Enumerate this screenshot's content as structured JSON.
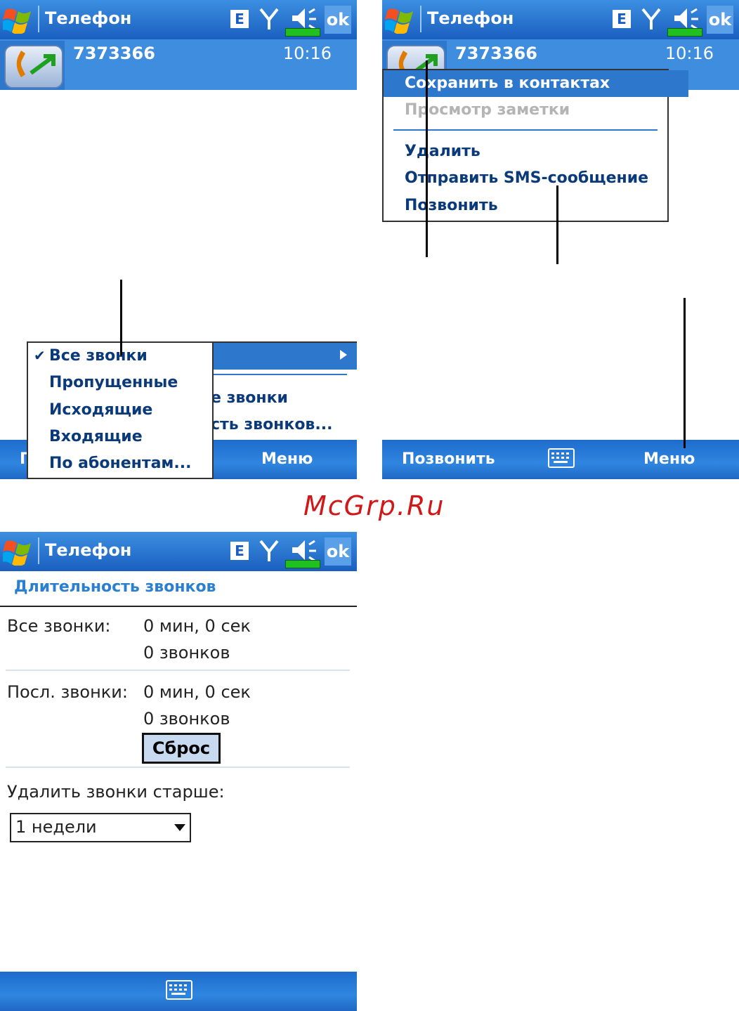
{
  "title_bar": {
    "title": "Телефон",
    "e_label": "E",
    "ok_label": "ok"
  },
  "call_info": {
    "number": "7373366",
    "time": "10:16"
  },
  "screen1": {
    "filter_menu": {
      "items": [
        {
          "label": "Все звонки",
          "checked": true
        },
        {
          "label": "Пропущенные",
          "checked": false
        },
        {
          "label": "Исходящие",
          "checked": false
        },
        {
          "label": "Входящие",
          "checked": false
        },
        {
          "label": "По абонентам...",
          "checked": false
        }
      ],
      "check_mark": "✔"
    },
    "main_menu_partial": {
      "item1": "е звонки",
      "item2": "сть звонков..."
    },
    "softkey_left_partial": "П",
    "softkey_right": "Меню"
  },
  "screen2": {
    "context_menu": {
      "items": [
        {
          "label": "Сохранить в контактах",
          "enabled": true,
          "highlighted": true
        },
        {
          "label": "Просмотр заметки",
          "enabled": false,
          "highlighted": false
        },
        {
          "label": "Удалить",
          "enabled": true,
          "highlighted": false
        },
        {
          "label": "Отправить SMS-сообщение",
          "enabled": true,
          "highlighted": false
        },
        {
          "label": "Позвонить",
          "enabled": true,
          "highlighted": false
        }
      ]
    },
    "softkey_left": "Позвонить",
    "softkey_right": "Меню"
  },
  "watermark": "McGrp.Ru",
  "screen3": {
    "section_title": "Длительность звонков",
    "all_calls_label": "Все звонки:",
    "all_calls_duration": "0 мин, 0 сек",
    "all_calls_count": "0 звонков",
    "recent_calls_label": "Посл. звонки:",
    "recent_calls_duration": "0 мин, 0 сек",
    "recent_calls_count": "0 звонков",
    "reset_button": "Сброс",
    "delete_older_label": "Удалить звонки старше:",
    "delete_older_value": "1 недели"
  },
  "colors": {
    "titlebar": "#1a5fc0",
    "menu_highlight": "#2d78cc",
    "section_title": "#2a7fd0"
  }
}
